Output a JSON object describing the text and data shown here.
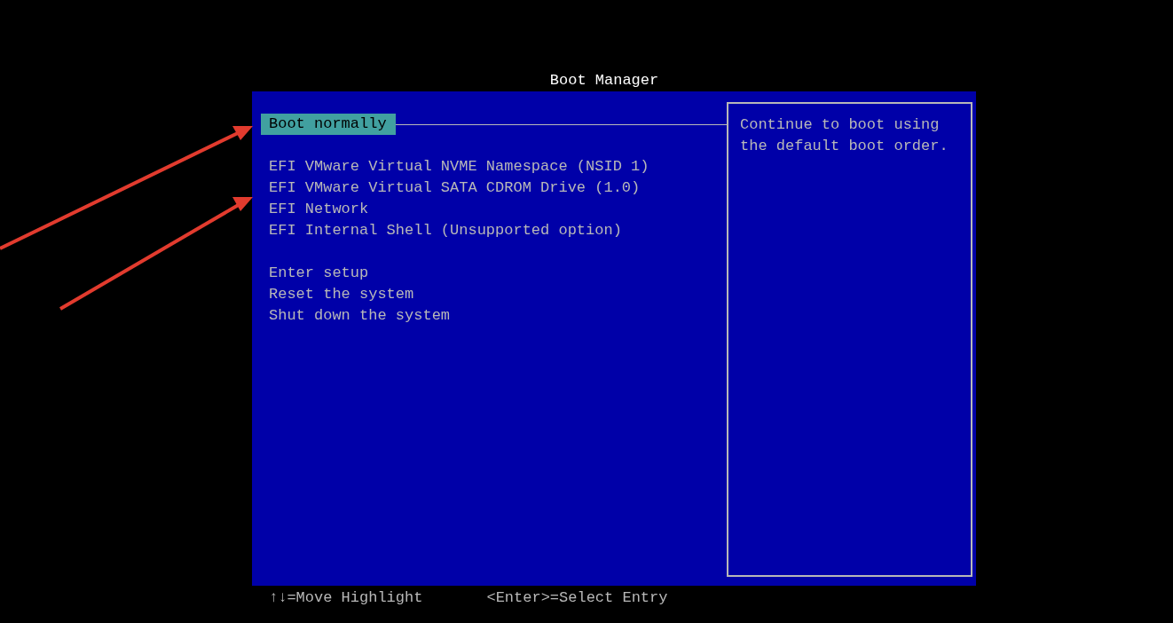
{
  "title": "Boot Manager",
  "menu_groups": [
    [
      {
        "label": "Boot normally",
        "selected": true
      }
    ],
    [
      {
        "label": "EFI VMware Virtual NVME Namespace (NSID 1)",
        "selected": false
      },
      {
        "label": "EFI VMware Virtual SATA CDROM Drive (1.0)",
        "selected": false
      },
      {
        "label": "EFI Network",
        "selected": false
      },
      {
        "label": "EFI Internal Shell (Unsupported option)",
        "selected": false
      }
    ],
    [
      {
        "label": "Enter setup",
        "selected": false
      },
      {
        "label": "Reset the system",
        "selected": false
      },
      {
        "label": "Shut down the system",
        "selected": false
      }
    ]
  ],
  "help_text": [
    "Continue to boot using",
    "the default boot order."
  ],
  "footer": [
    "↑↓=Move Highlight",
    "<Enter>=Select Entry"
  ]
}
